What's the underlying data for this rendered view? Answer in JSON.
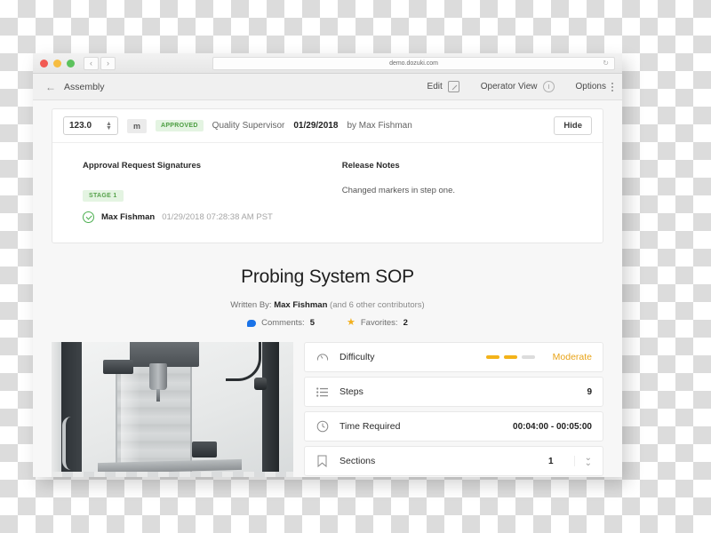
{
  "browser": {
    "url": "demo.dozuki.com",
    "reload_icon": "reload-icon",
    "back_label": "‹",
    "forward_label": "›"
  },
  "topbar": {
    "back_arrow": "←",
    "breadcrumb": "Assembly",
    "edit_label": "Edit",
    "operator_view_label": "Operator View",
    "options_label": "Options"
  },
  "approval": {
    "version": "123.0",
    "unit": "m",
    "status_badge": "APPROVED",
    "role": "Quality Supervisor",
    "date": "01/29/2018",
    "by": "by Max Fishman",
    "hide_label": "Hide",
    "signatures_heading": "Approval Request Signatures",
    "stage_badge": "STAGE 1",
    "signer_name": "Max Fishman",
    "signer_timestamp": "01/29/2018 07:28:38 AM PST",
    "release_notes_heading": "Release Notes",
    "release_notes_text": "Changed markers in step one."
  },
  "document": {
    "title": "Probing System SOP",
    "written_by_label": "Written By:",
    "author": "Max Fishman",
    "contributors": "(and 6 other contributors)",
    "comments_label": "Comments:",
    "comments_count": "5",
    "favorites_label": "Favorites:",
    "favorites_count": "2"
  },
  "info_rows": {
    "difficulty_label": "Difficulty",
    "difficulty_value": "Moderate",
    "difficulty_filled": 2,
    "difficulty_total": 3,
    "steps_label": "Steps",
    "steps_value": "9",
    "time_label": "Time Required",
    "time_value": "00:04:00 - 00:05:00",
    "sections_label": "Sections",
    "sections_value": "1"
  },
  "colors": {
    "approved_green": "#4a9c3f",
    "difficulty_amber": "#f3b319",
    "star_yellow": "#f2b01e",
    "comment_blue": "#1a73e8"
  }
}
